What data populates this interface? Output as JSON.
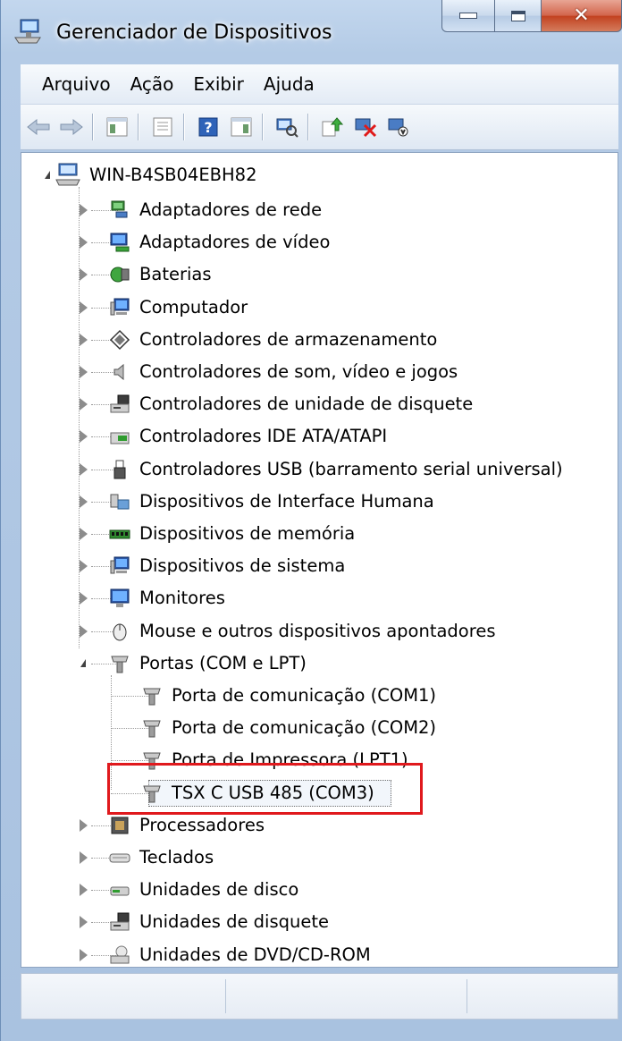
{
  "window": {
    "title": "Gerenciador de Dispositivos",
    "icon": "device-manager-icon",
    "controls": [
      "minimize",
      "maximize",
      "close"
    ],
    "close_color": "#c2411f"
  },
  "menu": [
    "Arquivo",
    "Ação",
    "Exibir",
    "Ajuda"
  ],
  "toolbar": [
    {
      "icon": "back-arrow-icon"
    },
    {
      "icon": "forward-arrow-icon"
    },
    {
      "icon": "show-hide-console-tree-icon"
    },
    {
      "icon": "properties-icon"
    },
    {
      "icon": "help-icon"
    },
    {
      "icon": "action-pane-icon"
    },
    {
      "icon": "scan-hardware-changes-icon"
    },
    {
      "icon": "update-driver-icon"
    },
    {
      "icon": "uninstall-device-icon"
    },
    {
      "icon": "disable-device-icon"
    }
  ],
  "tree": {
    "root": "WIN-B4SB04EBH82",
    "items": [
      {
        "label": "Adaptadores de rede",
        "icon": "network-adapter-icon"
      },
      {
        "label": "Adaptadores de vídeo",
        "icon": "display-adapter-icon"
      },
      {
        "label": "Baterias",
        "icon": "battery-icon"
      },
      {
        "label": "Computador",
        "icon": "computer-icon"
      },
      {
        "label": "Controladores de armazenamento",
        "icon": "storage-controller-icon"
      },
      {
        "label": "Controladores de som, vídeo e jogos",
        "icon": "speaker-icon"
      },
      {
        "label": "Controladores de unidade de disquete",
        "icon": "floppy-controller-icon"
      },
      {
        "label": "Controladores IDE ATA/ATAPI",
        "icon": "ide-controller-icon"
      },
      {
        "label": "Controladores USB (barramento serial universal)",
        "icon": "usb-icon"
      },
      {
        "label": "Dispositivos de Interface Humana",
        "icon": "hid-icon"
      },
      {
        "label": "Dispositivos de memória",
        "icon": "memory-icon"
      },
      {
        "label": "Dispositivos de sistema",
        "icon": "system-device-icon"
      },
      {
        "label": "Monitores",
        "icon": "monitor-icon"
      },
      {
        "label": "Mouse e outros dispositivos apontadores",
        "icon": "mouse-icon"
      },
      {
        "label": "Portas (COM e LPT)",
        "icon": "port-icon",
        "expanded": true,
        "children": [
          {
            "label": "Porta de comunicação (COM1)",
            "icon": "port-icon"
          },
          {
            "label": "Porta de comunicação (COM2)",
            "icon": "port-icon"
          },
          {
            "label": "Porta de Impressora (LPT1)",
            "icon": "port-icon"
          },
          {
            "label": "TSX C USB 485 (COM3)",
            "icon": "port-icon",
            "selected": true
          }
        ]
      },
      {
        "label": "Processadores",
        "icon": "processor-icon"
      },
      {
        "label": "Teclados",
        "icon": "keyboard-icon"
      },
      {
        "label": "Unidades de disco",
        "icon": "disk-drive-icon"
      },
      {
        "label": "Unidades de disquete",
        "icon": "floppy-drive-icon"
      },
      {
        "label": "Unidades de DVD/CD-ROM",
        "icon": "dvd-drive-icon"
      }
    ]
  },
  "highlight_color": "#e0191d"
}
